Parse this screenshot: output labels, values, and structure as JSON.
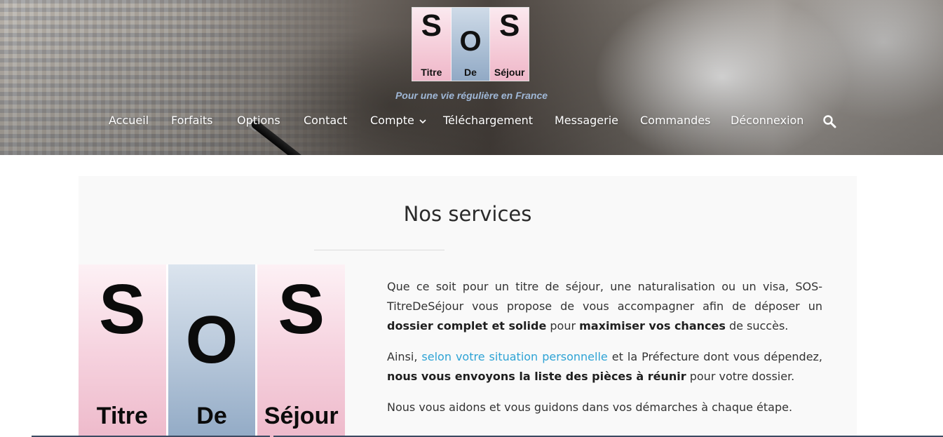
{
  "logo": {
    "letters": [
      "S",
      "O",
      "S"
    ],
    "words": [
      "Titre",
      "De",
      "Séjour"
    ]
  },
  "tagline": "Pour une vie régulière en France",
  "nav": {
    "items": [
      "Accueil",
      "Forfaits",
      "Options",
      "Contact",
      "Compte",
      "Téléchargement",
      "Messagerie",
      "Commandes",
      "Déconnexion"
    ],
    "search_icon": "search-icon",
    "dropdown_icon": "chevron-down-icon"
  },
  "main": {
    "title": "Nos services",
    "p1": {
      "t1": "Que ce soit pour un titre de séjour, une naturalisation ou un visa, SOS-TitreDeSéjour vous propose de vous accompagner afin de déposer un ",
      "b1": "dossier complet et solide",
      "t2": " pour ",
      "b2": "maximiser vos chances",
      "t3": " de succès."
    },
    "p2": {
      "t1": "Ainsi, ",
      "link": "selon votre situation personnelle",
      "t2": " et la Préfecture dont vous dépendez, ",
      "b1": "nous vous envoyons la liste des pièces à réunir",
      "t3": " pour votre dossier."
    },
    "p3": "Nous vous aidons et vous guidons dans vos démarches à chaque étape."
  },
  "colors": {
    "link": "#2ea3d5",
    "tagline": "#9fb7d6",
    "logo_pink": "#eebacb",
    "logo_blue": "#93abc6"
  }
}
